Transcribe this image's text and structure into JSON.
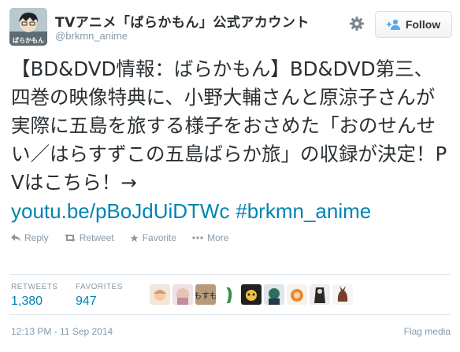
{
  "account": {
    "display_name": "TVアニメ「ばらかもん」公式アカウント",
    "handle": "@brkmn_anime",
    "follow_label": "Follow",
    "avatar_logo_text": "ばらかもん"
  },
  "tweet": {
    "text": "【BD&DVD情報：ばらかもん】BD&DVD第三、四巻の映像特典に、小野大輔さんと原涼子さんが実際に五島を旅する様子をおさめた「おのせんせい／はらすずこの五島ばらか旅」の収録が決定！PVはこちら！→",
    "link": "youtu.be/pBoJdUiDTWc",
    "hashtag": "#brkmn_anime"
  },
  "actions": {
    "reply": "Reply",
    "retweet": "Retweet",
    "favorite": "Favorite",
    "more": "More"
  },
  "stats": {
    "retweets_label": "RETWEETS",
    "retweets": "1,380",
    "favorites_label": "FAVORITES",
    "favorites": "947",
    "face_badge_text": "もすも"
  },
  "footer": {
    "timestamp": "12:13 PM - 11 Sep 2014",
    "flag": "Flag media"
  },
  "colors": {
    "link": "#0084b4",
    "muted": "#8899a6",
    "text": "#292f33"
  },
  "icons": [
    "gear-icon",
    "follow-person-icon",
    "reply-icon",
    "retweet-icon",
    "favorite-star-icon",
    "more-dots-icon"
  ]
}
